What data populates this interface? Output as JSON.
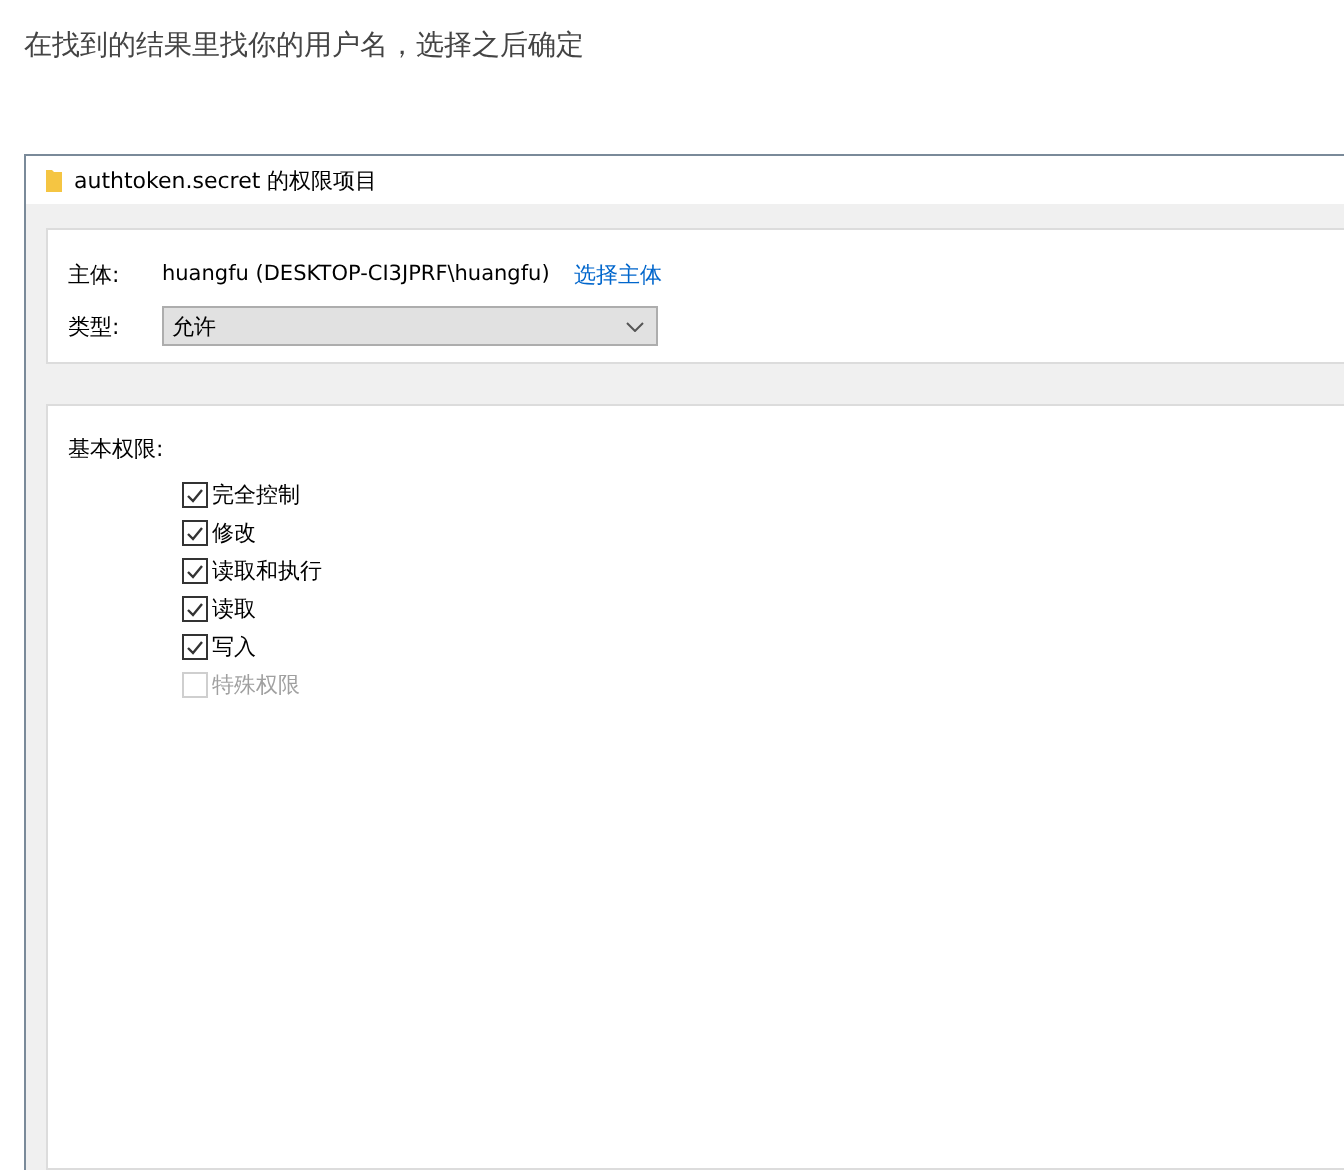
{
  "caption": "在找到的结果里找你的用户名，选择之后确定",
  "window": {
    "title": "authtoken.secret 的权限项目"
  },
  "principal": {
    "label": "主体:",
    "value": "huangfu (DESKTOP-CI3JPRF\\huangfu)",
    "link": "选择主体"
  },
  "type": {
    "label": "类型:",
    "value": "允许"
  },
  "permissions": {
    "heading": "基本权限:",
    "items": [
      {
        "label": "完全控制",
        "checked": true,
        "disabled": false
      },
      {
        "label": "修改",
        "checked": true,
        "disabled": false
      },
      {
        "label": "读取和执行",
        "checked": true,
        "disabled": false
      },
      {
        "label": "读取",
        "checked": true,
        "disabled": false
      },
      {
        "label": "写入",
        "checked": true,
        "disabled": false
      },
      {
        "label": "特殊权限",
        "checked": false,
        "disabled": true
      }
    ]
  }
}
